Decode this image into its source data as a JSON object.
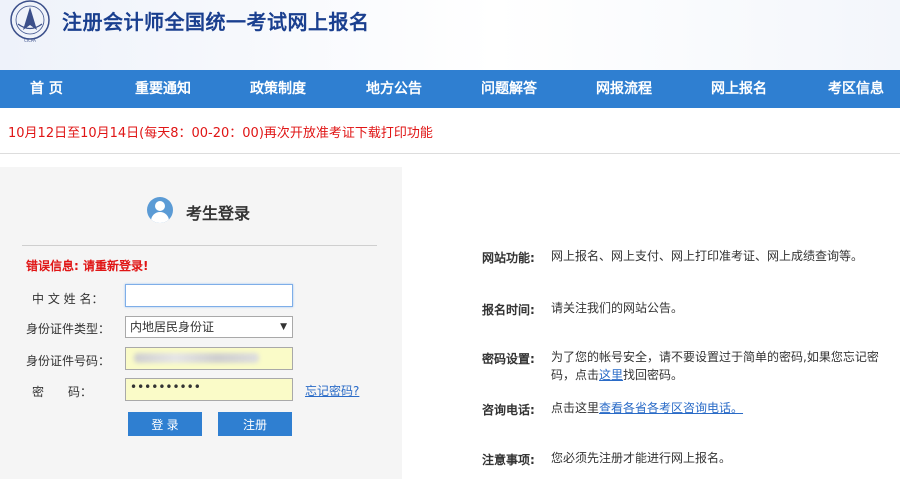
{
  "header": {
    "title": "注册会计师全国统一考试网上报名"
  },
  "nav": {
    "items": [
      {
        "label": "首 页"
      },
      {
        "label": "重要通知"
      },
      {
        "label": "政策制度"
      },
      {
        "label": "地方公告"
      },
      {
        "label": "问题解答"
      },
      {
        "label": "网报流程"
      },
      {
        "label": "网上报名"
      },
      {
        "label": "考区信息"
      }
    ]
  },
  "notice": {
    "text": "10月12日至10月14日(每天8：00-20：00)再次开放准考证下载打印功能"
  },
  "login": {
    "title": "考生登录",
    "error": "错误信息: 请重新登录!",
    "name_label": "中 文 姓 名：",
    "name_value": "",
    "id_type_label": "身份证件类型：",
    "id_type_value": "内地居民身份证",
    "id_number_label": "身份证件号码：",
    "password_label": "密　　码：",
    "password_value": "••••••••••",
    "forgot_link": "忘记密码?",
    "login_button": "登 录",
    "register_button": "注册"
  },
  "info": {
    "function_label": "网站功能:",
    "function_text": "网上报名、网上支付、网上打印准考证、网上成绩查询等。",
    "time_label": "报名时间:",
    "time_text": "请关注我们的网站公告。",
    "password_label": "密码设置:",
    "password_text_1": "为了您的帐号安全，请不要设置过于简单的密码,如果您忘记密码，点击",
    "password_link": "这里",
    "password_text_2": "找回密码。",
    "phone_label": "咨询电话:",
    "phone_text": "点击这里",
    "phone_link": "查看各省各考区咨询电话。",
    "notes_label": "注意事项:",
    "notes_text": "您必须先注册才能进行网上报名。"
  },
  "colors": {
    "nav_bg": "#2f7fd1",
    "title_blue": "#1a3f8f",
    "error_red": "#e01515",
    "link_blue": "#2a6bc7"
  }
}
